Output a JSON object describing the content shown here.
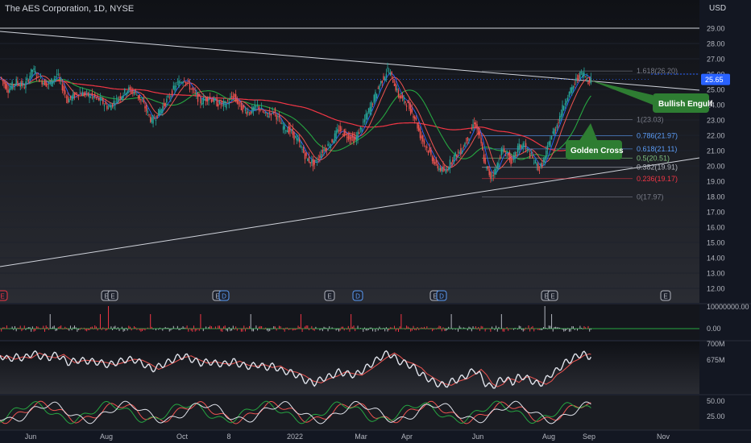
{
  "header": {
    "title": "The AES Corporation, 1D, NYSE",
    "currency": "USD"
  },
  "chart_data": [
    {
      "type": "candlestick",
      "title": "The AES Corporation, 1D, NYSE",
      "y_ticks": [
        29.0,
        28.0,
        27.0,
        26.0,
        25.0,
        24.0,
        23.0,
        22.0,
        21.0,
        20.0,
        19.0,
        18.0,
        17.0,
        16.0,
        15.0,
        14.0,
        13.0,
        12.0
      ],
      "y_tick_labels": [
        "29.00",
        "28.00",
        "27.00",
        "26.00",
        "25.00",
        "24.00",
        "23.00",
        "22.00",
        "21.00",
        "20.00",
        "19.00",
        "18.00",
        "17.00",
        "16.00",
        "15.00",
        "14.00",
        "13.00",
        "12.00"
      ],
      "ylim": [
        11.2,
        30.2
      ],
      "x_labels": [
        "Jun",
        "Aug",
        "Oct",
        "8",
        "2022",
        "Mar",
        "Apr",
        "Jun",
        "Aug",
        "Sep",
        "Nov"
      ],
      "last_price": 25.65,
      "last_price_label": "25.65",
      "close_path": [
        {
          "t": 0,
          "y": 25.8
        },
        {
          "t": 6,
          "y": 25.0
        },
        {
          "t": 12,
          "y": 25.5
        },
        {
          "t": 18,
          "y": 25.2
        },
        {
          "t": 24,
          "y": 26.3
        },
        {
          "t": 30,
          "y": 25.6
        },
        {
          "t": 36,
          "y": 25.3
        },
        {
          "t": 42,
          "y": 26.0
        },
        {
          "t": 50,
          "y": 24.3
        },
        {
          "t": 58,
          "y": 24.8
        },
        {
          "t": 66,
          "y": 24.6
        },
        {
          "t": 74,
          "y": 24.3
        },
        {
          "t": 80,
          "y": 23.8
        },
        {
          "t": 88,
          "y": 24.5
        },
        {
          "t": 94,
          "y": 25.0
        },
        {
          "t": 100,
          "y": 24.8
        },
        {
          "t": 106,
          "y": 24.0
        },
        {
          "t": 112,
          "y": 22.9
        },
        {
          "t": 118,
          "y": 23.6
        },
        {
          "t": 124,
          "y": 24.4
        },
        {
          "t": 130,
          "y": 25.3
        },
        {
          "t": 136,
          "y": 25.7
        },
        {
          "t": 142,
          "y": 24.9
        },
        {
          "t": 148,
          "y": 24.2
        },
        {
          "t": 154,
          "y": 24.5
        },
        {
          "t": 160,
          "y": 24.1
        },
        {
          "t": 166,
          "y": 24.0
        },
        {
          "t": 172,
          "y": 24.6
        },
        {
          "t": 178,
          "y": 23.8
        },
        {
          "t": 184,
          "y": 23.5
        },
        {
          "t": 190,
          "y": 23.9
        },
        {
          "t": 196,
          "y": 23.3
        },
        {
          "t": 202,
          "y": 23.6
        },
        {
          "t": 208,
          "y": 22.6
        },
        {
          "t": 214,
          "y": 22.3
        },
        {
          "t": 220,
          "y": 21.6
        },
        {
          "t": 226,
          "y": 20.5
        },
        {
          "t": 232,
          "y": 20.1
        },
        {
          "t": 238,
          "y": 21.0
        },
        {
          "t": 244,
          "y": 21.5
        },
        {
          "t": 250,
          "y": 22.4
        },
        {
          "t": 256,
          "y": 22.0
        },
        {
          "t": 262,
          "y": 21.7
        },
        {
          "t": 268,
          "y": 22.8
        },
        {
          "t": 274,
          "y": 24.0
        },
        {
          "t": 280,
          "y": 25.3
        },
        {
          "t": 286,
          "y": 26.3
        },
        {
          "t": 290,
          "y": 25.6
        },
        {
          "t": 294,
          "y": 24.6
        },
        {
          "t": 300,
          "y": 24.1
        },
        {
          "t": 306,
          "y": 23.2
        },
        {
          "t": 310,
          "y": 22.0
        },
        {
          "t": 316,
          "y": 21.0
        },
        {
          "t": 322,
          "y": 20.0
        },
        {
          "t": 328,
          "y": 19.6
        },
        {
          "t": 334,
          "y": 20.5
        },
        {
          "t": 340,
          "y": 21.0
        },
        {
          "t": 346,
          "y": 22.0
        },
        {
          "t": 350,
          "y": 22.9
        },
        {
          "t": 354,
          "y": 21.8
        },
        {
          "t": 358,
          "y": 20.0
        },
        {
          "t": 362,
          "y": 19.3
        },
        {
          "t": 366,
          "y": 19.8
        },
        {
          "t": 370,
          "y": 21.0
        },
        {
          "t": 374,
          "y": 20.8
        },
        {
          "t": 378,
          "y": 20.2
        },
        {
          "t": 382,
          "y": 21.2
        },
        {
          "t": 386,
          "y": 21.4
        },
        {
          "t": 390,
          "y": 20.9
        },
        {
          "t": 394,
          "y": 20.3
        },
        {
          "t": 398,
          "y": 19.8
        },
        {
          "t": 402,
          "y": 20.5
        },
        {
          "t": 406,
          "y": 21.8
        },
        {
          "t": 410,
          "y": 22.5
        },
        {
          "t": 414,
          "y": 23.5
        },
        {
          "t": 418,
          "y": 24.5
        },
        {
          "t": 422,
          "y": 25.0
        },
        {
          "t": 426,
          "y": 25.8
        },
        {
          "t": 430,
          "y": 26.1
        },
        {
          "t": 434,
          "y": 25.6
        },
        {
          "t": 436,
          "y": 25.65
        }
      ],
      "fibonacci": [
        {
          "ratio": "1.618",
          "price": 26.2,
          "label": "1.618(26.20)"
        },
        {
          "ratio": "1",
          "price": 23.03,
          "label": "1(23.03)"
        },
        {
          "ratio": "0.786",
          "price": 21.97,
          "label": "0.786(21.97)"
        },
        {
          "ratio": "0.618",
          "price": 21.11,
          "label": "0.618(21.11)"
        },
        {
          "ratio": "0.5",
          "price": 20.51,
          "label": "0.5(20.51)"
        },
        {
          "ratio": "0.382",
          "price": 19.91,
          "label": "0.382(19.91)"
        },
        {
          "ratio": "0.236",
          "price": 19.17,
          "label": "0.236(19.17)"
        },
        {
          "ratio": "0",
          "price": 17.97,
          "label": "0(17.97)"
        }
      ],
      "annotations": [
        {
          "text": "Golden Cross",
          "color": "#2e7d32"
        },
        {
          "text": "Bullish Engulf",
          "color": "#2e7d32"
        }
      ],
      "event_markers": [
        "E",
        "E",
        "E",
        "E",
        "D",
        "E",
        "D",
        "E",
        "D",
        "E",
        "E"
      ],
      "colors": {
        "up": "#26a69a",
        "down": "#ef5350",
        "ma_fast": "#2962ff",
        "ma_mid": "#ef5350",
        "ma_green": "#26a641",
        "ma_slow": "#f23645",
        "last_price": "#2962ff"
      }
    },
    {
      "type": "histogram",
      "name": "volume-oscillator",
      "y_tick_labels": [
        "10000000.00",
        "0.00"
      ]
    },
    {
      "type": "line",
      "name": "obv",
      "y_tick_labels": [
        "700M",
        "675M"
      ]
    },
    {
      "type": "line",
      "name": "dmi",
      "y_tick_labels": [
        "50.00",
        "25.00"
      ]
    }
  ]
}
